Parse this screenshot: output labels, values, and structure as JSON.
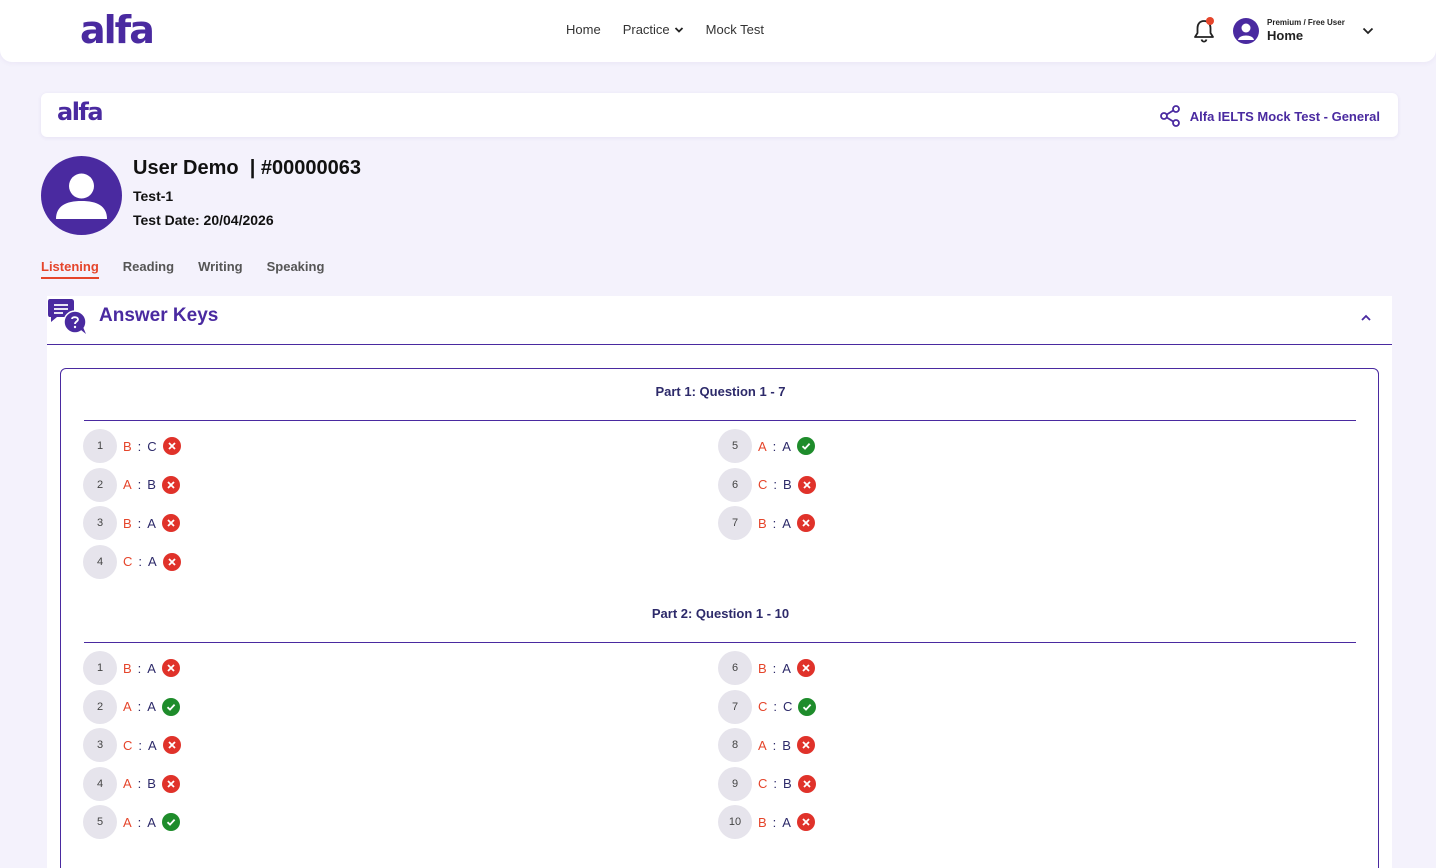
{
  "brand": {
    "logo_text": "alfa"
  },
  "nav": {
    "home": "Home",
    "practice": "Practice",
    "mock_test": "Mock Test"
  },
  "user_menu": {
    "plan": "Premium / Free User",
    "label": "Home"
  },
  "banner": {
    "logo_text": "alfa",
    "test_name": "Alfa IELTS Mock Test - General"
  },
  "profile": {
    "name_line": "User Demo  | #00000063",
    "test": "Test-1",
    "test_date": "Test Date: 20/04/2026"
  },
  "tabs": [
    "Listening",
    "Reading",
    "Writing",
    "Speaking"
  ],
  "active_tab": "Listening",
  "answer_keys": {
    "title": "Answer Keys",
    "parts": [
      {
        "title": "Part 1: Question 1 - 7",
        "answers": [
          {
            "num": "1",
            "user": "B",
            "correct": "C",
            "status": "wrong"
          },
          {
            "num": "2",
            "user": "A",
            "correct": "B",
            "status": "wrong"
          },
          {
            "num": "3",
            "user": "B",
            "correct": "A",
            "status": "wrong"
          },
          {
            "num": "4",
            "user": "C",
            "correct": "A",
            "status": "wrong"
          },
          {
            "num": "5",
            "user": "A",
            "correct": "A",
            "status": "right"
          },
          {
            "num": "6",
            "user": "C",
            "correct": "B",
            "status": "wrong"
          },
          {
            "num": "7",
            "user": "B",
            "correct": "A",
            "status": "wrong"
          }
        ]
      },
      {
        "title": "Part 2: Question 1 - 10",
        "answers": [
          {
            "num": "1",
            "user": "B",
            "correct": "A",
            "status": "wrong"
          },
          {
            "num": "2",
            "user": "A",
            "correct": "A",
            "status": "right"
          },
          {
            "num": "3",
            "user": "C",
            "correct": "A",
            "status": "wrong"
          },
          {
            "num": "4",
            "user": "A",
            "correct": "B",
            "status": "wrong"
          },
          {
            "num": "5",
            "user": "A",
            "correct": "A",
            "status": "right"
          },
          {
            "num": "6",
            "user": "B",
            "correct": "A",
            "status": "wrong"
          },
          {
            "num": "7",
            "user": "C",
            "correct": "C",
            "status": "right"
          },
          {
            "num": "8",
            "user": "A",
            "correct": "B",
            "status": "wrong"
          },
          {
            "num": "9",
            "user": "C",
            "correct": "B",
            "status": "wrong"
          },
          {
            "num": "10",
            "user": "B",
            "correct": "A",
            "status": "wrong"
          }
        ]
      }
    ]
  },
  "colors": {
    "brand": "#4a2aa0",
    "accent": "#e5452b",
    "right": "#1e8c2b",
    "wrong": "#e0322a"
  }
}
